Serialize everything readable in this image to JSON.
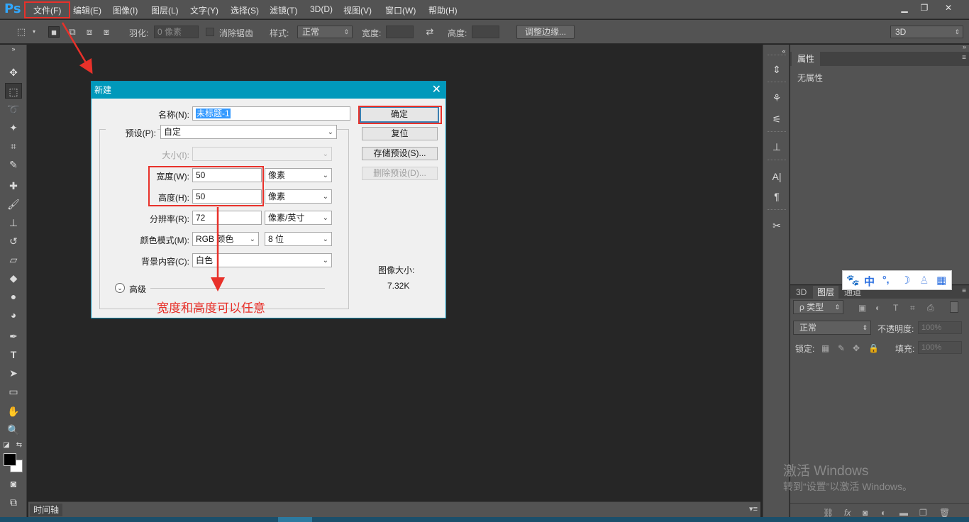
{
  "app": {
    "logo": "Ps",
    "menu": [
      "文件(F)",
      "编辑(E)",
      "图像(I)",
      "图层(L)",
      "文字(Y)",
      "选择(S)",
      "滤镜(T)",
      "3D(D)",
      "视图(V)",
      "窗口(W)",
      "帮助(H)"
    ],
    "window_controls": [
      "minimize-icon",
      "restore-icon",
      "close-icon"
    ]
  },
  "options_bar": {
    "feather_label": "羽化:",
    "feather_value": "0 像素",
    "antialias_label": "消除锯齿",
    "style_label": "样式:",
    "style_value": "正常",
    "width_label": "宽度:",
    "height_label": "高度:",
    "refine_button": "调整边缘...",
    "workspace_value": "3D"
  },
  "timeline": {
    "tab": "时间轴"
  },
  "properties_panel": {
    "tab": "属性",
    "body": "无属性"
  },
  "layers_panel": {
    "tabs": [
      "3D",
      "图层",
      "通道"
    ],
    "filter_value": "ρ 类型",
    "blend_mode": "正常",
    "opacity_label": "不透明度:",
    "opacity_value": "100%",
    "lock_label": "锁定:",
    "fill_label": "填充:",
    "fill_value": "100%"
  },
  "ime": {
    "items": [
      "中",
      "°,",
      "☽"
    ]
  },
  "watermark": {
    "line1": "激活 Windows",
    "line2": "转到“设置”以激活 Windows。"
  },
  "dialog": {
    "title": "新建",
    "name_label": "名称(N):",
    "name_value": "未标题-1",
    "preset_label": "预设(P):",
    "preset_value": "自定",
    "size_label": "大小(I):",
    "width_label": "宽度(W):",
    "width_value": "50",
    "width_unit": "像素",
    "height_label": "高度(H):",
    "height_value": "50",
    "height_unit": "像素",
    "resolution_label": "分辨率(R):",
    "resolution_value": "72",
    "resolution_unit": "像素/英寸",
    "color_mode_label": "颜色模式(M):",
    "color_mode_value": "RGB 颜色",
    "bit_depth_value": "8 位",
    "background_label": "背景内容(C):",
    "background_value": "白色",
    "advanced_label": "高级",
    "ok_button": "确定",
    "reset_button": "复位",
    "save_preset_button": "存储预设(S)...",
    "delete_preset_button": "删除预设(D)...",
    "image_size_label": "图像大小:",
    "image_size_value": "7.32K",
    "annotation": "宽度和高度可以任意"
  },
  "colors": {
    "annotation_red": "#e8312a",
    "dialog_title_bar": "#0099bb",
    "app_background": "#262626",
    "panel_gray": "#535353"
  }
}
